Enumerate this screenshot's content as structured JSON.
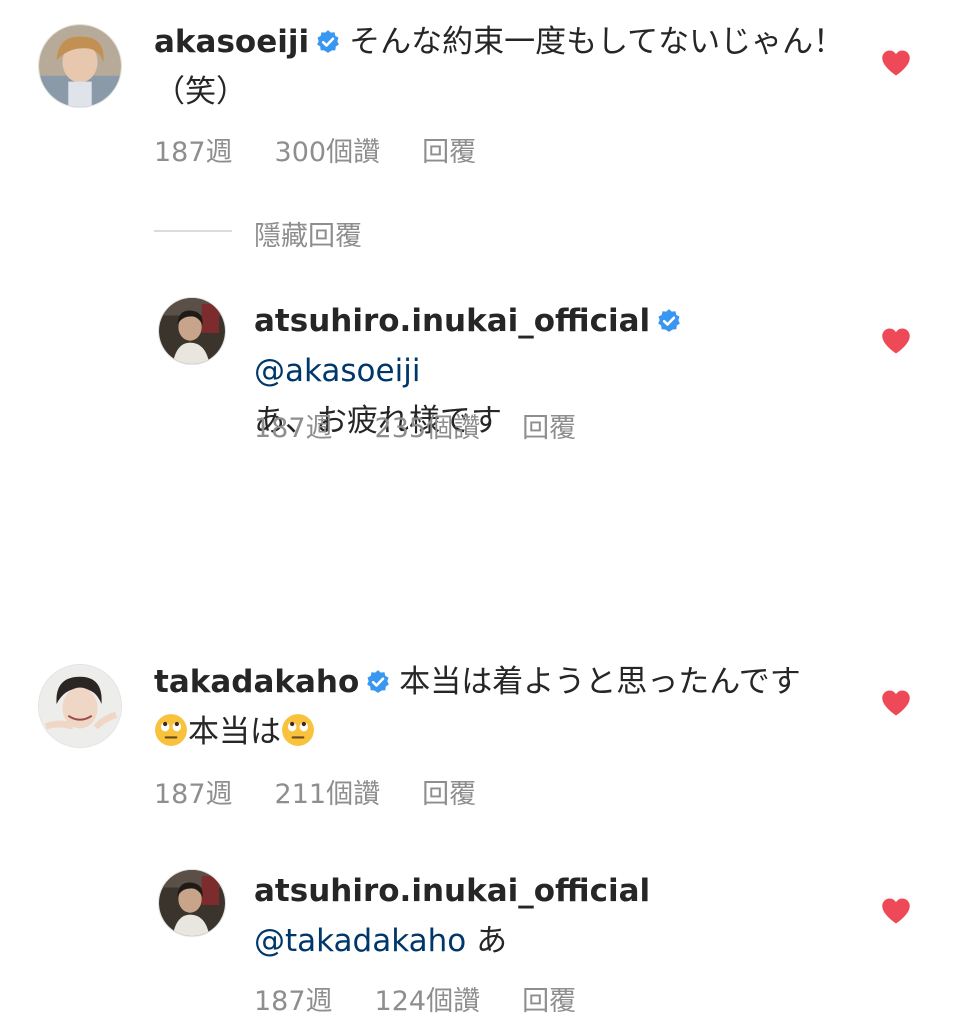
{
  "comments": [
    {
      "username": "akasoeiji",
      "text": "そんな約束一度もしてないじゃん！（笑）",
      "time": "187週",
      "likes": "300個讚",
      "reply_label": "回覆"
    },
    {
      "username": "atsuhiro.inukai_official",
      "mention": "@akasoeiji",
      "text": "あ、お疲れ様です",
      "time": "187週",
      "likes": "235個讚",
      "reply_label": "回覆"
    },
    {
      "username": "takadakaho",
      "text_1": "本当は着ようと思ったんです",
      "text_2": "本当は",
      "time": "187週",
      "likes": "211個讚",
      "reply_label": "回覆"
    },
    {
      "username": "atsuhiro.inukai_official",
      "mention": "@takadakaho",
      "text": "あ",
      "time": "187週",
      "likes": "124個讚",
      "reply_label": "回覆"
    }
  ],
  "hide_replies_label": "隱藏回覆",
  "colors": {
    "heart": "#ed4956",
    "verified": "#3897f0",
    "mention": "#00376b",
    "meta": "#8e8e8e"
  },
  "icons": [
    "verified-badge-icon",
    "heart-icon",
    "eye-roll-emoji-icon"
  ]
}
